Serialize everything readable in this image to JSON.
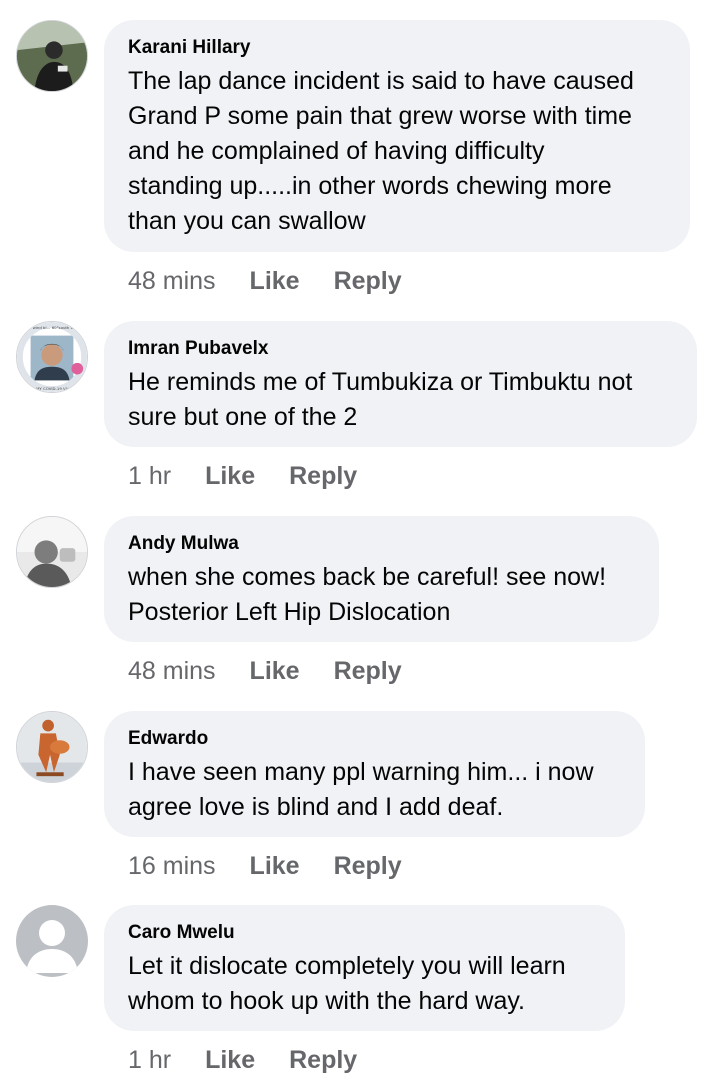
{
  "comments": [
    {
      "author": "Karani Hillary",
      "lines": [
        "The lap dance incident is said to have caused",
        "Grand P some pain that grew worse with time",
        "and he complained of having difficulty",
        "standing up.....in other words chewing more",
        "than you can swallow"
      ],
      "time": "48 mins",
      "like": "Like",
      "reply": "Reply"
    },
    {
      "author": "Imran Pubavelx",
      "lines": [
        "He reminds me of Tumbukiza or Timbuktu not",
        "sure but one of the 2"
      ],
      "time": "1 hr",
      "like": "Like",
      "reply": "Reply",
      "avatar_frame_top": "the wind bl… 60°south east",
      "avatar_frame_bottom": "I GOT MY COVID-19 VACCINE"
    },
    {
      "author": "Andy Mulwa",
      "lines": [
        "when she comes back be careful! see now!",
        "Posterior Left Hip Dislocation"
      ],
      "time": "48 mins",
      "like": "Like",
      "reply": "Reply"
    },
    {
      "author": "Edwardo",
      "lines": [
        "I have seen many ppl warning him... i now",
        "agree love is blind and I add deaf."
      ],
      "time": "16 mins",
      "like": "Like",
      "reply": "Reply"
    },
    {
      "author": "Caro Mwelu",
      "lines": [
        "Let it dislocate completely you will learn",
        "whom to hook up with the hard way."
      ],
      "time": "1 hr",
      "like": "Like",
      "reply": "Reply"
    }
  ]
}
